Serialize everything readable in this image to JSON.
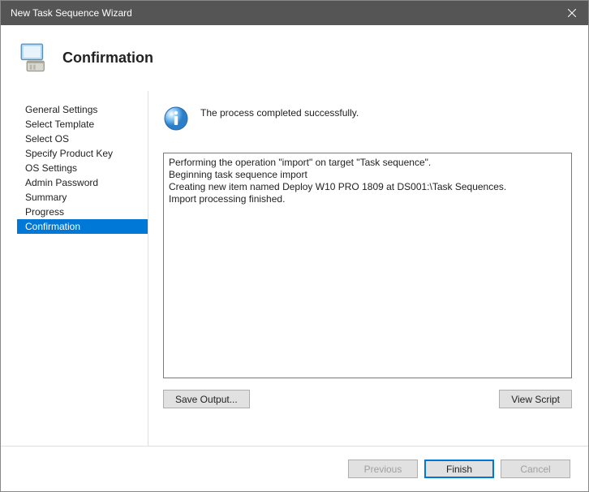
{
  "titlebar": {
    "title": "New Task Sequence Wizard"
  },
  "header": {
    "title": "Confirmation"
  },
  "sidebar": {
    "items": [
      {
        "label": "General Settings"
      },
      {
        "label": "Select Template"
      },
      {
        "label": "Select OS"
      },
      {
        "label": "Specify Product Key"
      },
      {
        "label": "OS Settings"
      },
      {
        "label": "Admin Password"
      },
      {
        "label": "Summary"
      },
      {
        "label": "Progress"
      },
      {
        "label": "Confirmation",
        "selected": true
      }
    ]
  },
  "main": {
    "status_text": "The process completed successfully.",
    "log_text": "Performing the operation \"import\" on target \"Task sequence\".\nBeginning task sequence import\nCreating new item named Deploy W10 PRO 1809 at DS001:\\Task Sequences.\nImport processing finished.",
    "save_output_label": "Save Output...",
    "view_script_label": "View Script"
  },
  "footer": {
    "previous_label": "Previous",
    "finish_label": "Finish",
    "cancel_label": "Cancel"
  }
}
